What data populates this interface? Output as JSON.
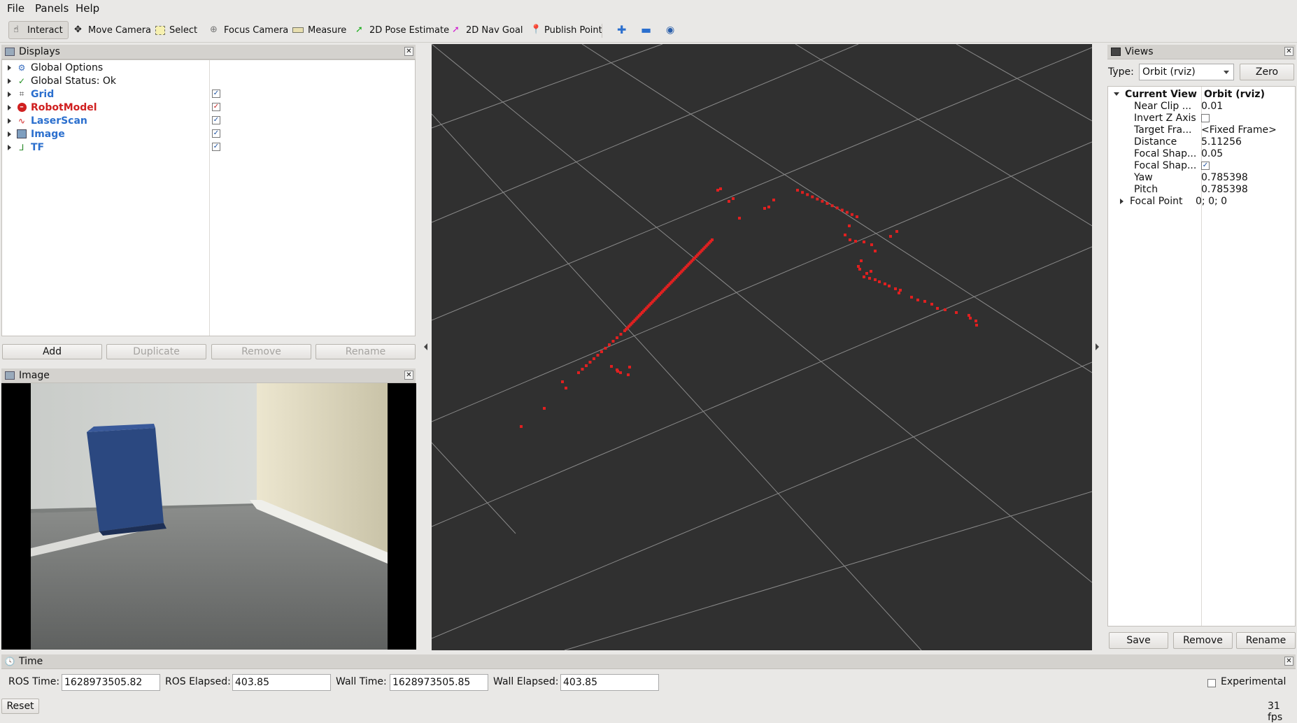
{
  "menu": {
    "file": "File",
    "panels": "Panels",
    "help": "Help"
  },
  "toolbar": {
    "interact": "Interact",
    "move_camera": "Move Camera",
    "select": "Select",
    "focus_camera": "Focus Camera",
    "measure": "Measure",
    "pose_estimate": "2D Pose Estimate",
    "nav_goal": "2D Nav Goal",
    "publish_point": "Publish Point"
  },
  "displays": {
    "title": "Displays",
    "items": [
      {
        "label": "Global Options",
        "icon": "gear-icon",
        "checked": null
      },
      {
        "label": "Global Status: Ok",
        "icon": "check-icon",
        "checked": null
      },
      {
        "label": "Grid",
        "icon": "grid-icon",
        "checked": true
      },
      {
        "label": "RobotModel",
        "icon": "error-icon",
        "checked": true
      },
      {
        "label": "LaserScan",
        "icon": "laser-icon",
        "checked": true
      },
      {
        "label": "Image",
        "icon": "image-icon",
        "checked": true
      },
      {
        "label": "TF",
        "icon": "axes-icon",
        "checked": true
      }
    ],
    "buttons": {
      "add": "Add",
      "duplicate": "Duplicate",
      "remove": "Remove",
      "rename": "Rename"
    }
  },
  "image_panel": {
    "title": "Image"
  },
  "views": {
    "title": "Views",
    "type_label": "Type:",
    "type_value": "Orbit (rviz)",
    "zero": "Zero",
    "current_view_label": "Current View",
    "current_view_value": "Orbit (rviz)",
    "props": [
      {
        "name": "Near Clip ...",
        "value": "0.01"
      },
      {
        "name": "Invert Z Axis",
        "value": ""
      },
      {
        "name": "Target Fra...",
        "value": "<Fixed Frame>"
      },
      {
        "name": "Distance",
        "value": "5.11256"
      },
      {
        "name": "Focal Shap...",
        "value": "0.05"
      },
      {
        "name": "Focal Shap...",
        "value": ""
      },
      {
        "name": "Yaw",
        "value": "0.785398"
      },
      {
        "name": "Pitch",
        "value": "0.785398"
      },
      {
        "name": "Focal Point",
        "value": "0; 0; 0"
      }
    ],
    "buttons": {
      "save": "Save",
      "remove": "Remove",
      "rename": "Rename"
    }
  },
  "time": {
    "title": "Time",
    "ros_time_label": "ROS Time:",
    "ros_time": "1628973505.82",
    "ros_elapsed_label": "ROS Elapsed:",
    "ros_elapsed": "403.85",
    "wall_time_label": "Wall Time:",
    "wall_time": "1628973505.85",
    "wall_elapsed_label": "Wall Elapsed:",
    "wall_elapsed": "403.85",
    "experimental": "Experimental",
    "reset": "Reset",
    "fps": "31 fps"
  },
  "colors": {
    "laser_points": "#e02020",
    "viewport_bg": "#303030",
    "grid": "#8a8a8a"
  }
}
